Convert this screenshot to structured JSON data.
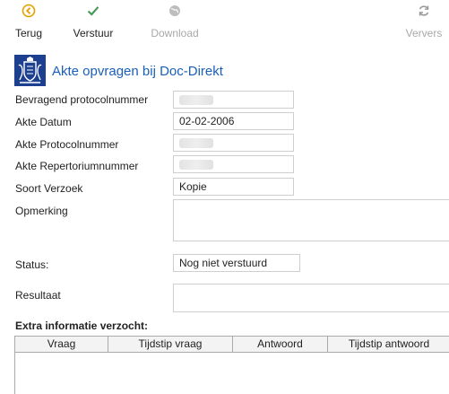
{
  "toolbar": {
    "back_label": "Terug",
    "send_label": "Verstuur",
    "download_label": "Download",
    "refresh_label": "Ververs"
  },
  "header": {
    "title": "Akte opvragen bij Doc-Direkt"
  },
  "form": {
    "bevragend_label": "Bevragend protocolnummer",
    "bevragend_value": "",
    "datum_label": "Akte Datum",
    "datum_value": "02-02-2006",
    "protocol_label": "Akte Protocolnummer",
    "protocol_value": "",
    "repertorium_label": "Akte Repertoriumnummer",
    "repertorium_value": "",
    "soort_label": "Soort Verzoek",
    "soort_value": "Kopie",
    "opmerking_label": "Opmerking",
    "opmerking_value": "",
    "status_label": "Status:",
    "status_value": "Nog niet verstuurd",
    "resultaat_label": "Resultaat",
    "resultaat_value": ""
  },
  "extra": {
    "title": "Extra informatie verzocht:",
    "columns": [
      "Vraag",
      "Tijdstip vraag",
      "Antwoord",
      "Tijdstip antwoord"
    ]
  },
  "colors": {
    "accent_title": "#1a5fb8",
    "back_icon": "#e8a000",
    "send_icon": "#4a9a5a",
    "disabled_text": "#a8a8a8"
  }
}
